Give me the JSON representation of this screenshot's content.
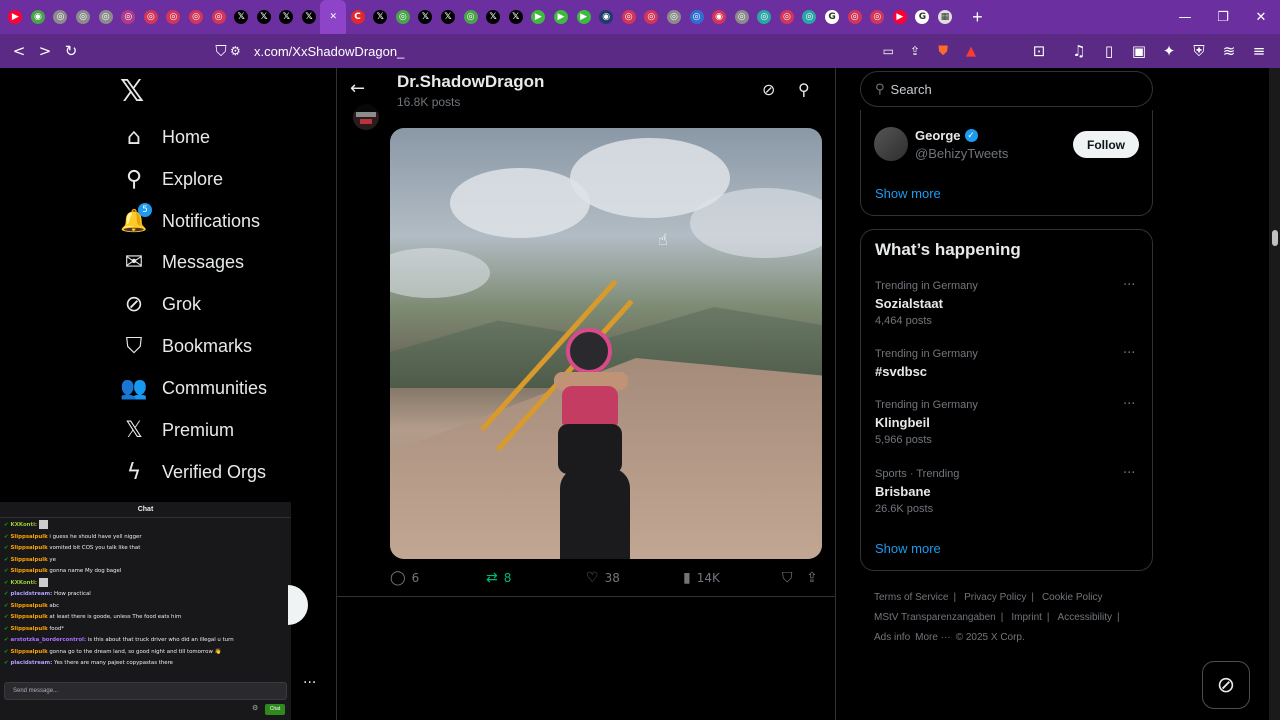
{
  "browser": {
    "tab_favicons": [
      {
        "icon": "youtube-icon",
        "color": "#ff0033",
        "glyph": "▶"
      },
      {
        "icon": "play-icon",
        "color": "#4aa34a",
        "glyph": "◉"
      },
      {
        "icon": "site-icon",
        "color": "#8b8b8b",
        "glyph": "◎"
      },
      {
        "icon": "site-icon",
        "color": "#8b8b8b",
        "glyph": "◎"
      },
      {
        "icon": "site-icon",
        "color": "#8b8b8b",
        "glyph": "◎"
      },
      {
        "icon": "site-icon",
        "color": "#b03a8a",
        "glyph": "◎"
      },
      {
        "icon": "site-icon",
        "color": "#d1365a",
        "glyph": "◎"
      },
      {
        "icon": "site-icon",
        "color": "#d1365a",
        "glyph": "◎"
      },
      {
        "icon": "site-icon",
        "color": "#d1365a",
        "glyph": "◎"
      },
      {
        "icon": "site-icon",
        "color": "#d1365a",
        "glyph": "◎"
      },
      {
        "icon": "x-icon",
        "color": "#000000",
        "glyph": "𝕏"
      },
      {
        "icon": "x-icon",
        "color": "#000000",
        "glyph": "𝕏"
      },
      {
        "icon": "x-icon",
        "color": "#000000",
        "glyph": "𝕏"
      },
      {
        "icon": "x-icon",
        "color": "#000000",
        "glyph": "𝕏"
      },
      {
        "icon": "close-tab-icon",
        "color": "#8e44c9",
        "glyph": "✕",
        "active": true
      },
      {
        "icon": "c-icon",
        "color": "#e0282e",
        "glyph": "C"
      },
      {
        "icon": "x-icon",
        "color": "#000000",
        "glyph": "𝕏"
      },
      {
        "icon": "site-icon",
        "color": "#4aa34a",
        "glyph": "◎"
      },
      {
        "icon": "x-icon",
        "color": "#000000",
        "glyph": "𝕏"
      },
      {
        "icon": "x-icon",
        "color": "#000000",
        "glyph": "𝕏"
      },
      {
        "icon": "site-icon",
        "color": "#4aa34a",
        "glyph": "◎"
      },
      {
        "icon": "x-icon",
        "color": "#000000",
        "glyph": "𝕏"
      },
      {
        "icon": "x-icon",
        "color": "#000000",
        "glyph": "𝕏"
      },
      {
        "icon": "play-icon",
        "color": "#3fb93f",
        "glyph": "▶"
      },
      {
        "icon": "play-icon",
        "color": "#3fb93f",
        "glyph": "▶"
      },
      {
        "icon": "play-icon",
        "color": "#3fb93f",
        "glyph": "▶"
      },
      {
        "icon": "site-icon",
        "color": "#1f3a6b",
        "glyph": "◉"
      },
      {
        "icon": "site-icon",
        "color": "#d1365a",
        "glyph": "◎"
      },
      {
        "icon": "site-icon",
        "color": "#d1365a",
        "glyph": "◎"
      },
      {
        "icon": "site-icon",
        "color": "#8b8b8b",
        "glyph": "◎"
      },
      {
        "icon": "site-icon",
        "color": "#2f6fd1",
        "glyph": "◎"
      },
      {
        "icon": "site-icon",
        "color": "#d1365a",
        "glyph": "◉"
      },
      {
        "icon": "site-icon",
        "color": "#8b8b8b",
        "glyph": "◎"
      },
      {
        "icon": "site-icon",
        "color": "#2aa6a6",
        "glyph": "◎"
      },
      {
        "icon": "site-icon",
        "color": "#d1365a",
        "glyph": "◎"
      },
      {
        "icon": "site-icon",
        "color": "#2aa6a6",
        "glyph": "◎"
      },
      {
        "icon": "google-icon",
        "color": "#ffffff",
        "glyph": "G"
      },
      {
        "icon": "site-icon",
        "color": "#d1365a",
        "glyph": "◎"
      },
      {
        "icon": "site-icon",
        "color": "#d1365a",
        "glyph": "◎"
      },
      {
        "icon": "youtube-icon",
        "color": "#ff0033",
        "glyph": "▶"
      },
      {
        "icon": "google-icon",
        "color": "#ffffff",
        "glyph": "G"
      },
      {
        "icon": "image-icon",
        "color": "#dddddd",
        "glyph": "▦"
      }
    ],
    "new_tab": "+",
    "url": "x.com/XxShadowDragon_",
    "accent": "#6b2fa0"
  },
  "nav": {
    "items": [
      {
        "label": "Home",
        "icon": "home-icon",
        "glyph": "⌂"
      },
      {
        "label": "Explore",
        "icon": "search-icon",
        "glyph": "⚲"
      },
      {
        "label": "Notifications",
        "icon": "bell-icon",
        "glyph": "🔔",
        "badge": "5"
      },
      {
        "label": "Messages",
        "icon": "envelope-icon",
        "glyph": "✉"
      },
      {
        "label": "Grok",
        "icon": "grok-icon",
        "glyph": "⊘"
      },
      {
        "label": "Bookmarks",
        "icon": "bookmark-icon",
        "glyph": "⛉"
      },
      {
        "label": "Communities",
        "icon": "communities-icon",
        "glyph": "👥"
      },
      {
        "label": "Premium",
        "icon": "x-premium-icon",
        "glyph": "𝕏"
      },
      {
        "label": "Verified Orgs",
        "icon": "lightning-icon",
        "glyph": "ϟ"
      }
    ]
  },
  "profile": {
    "title": "Dr.ShadowDragon",
    "post_count": "16.8K posts"
  },
  "post": {
    "replies": "6",
    "reposts": "8",
    "likes": "38",
    "views": "14K"
  },
  "right": {
    "search_placeholder": "Search",
    "who_to_follow": {
      "name": "George",
      "handle": "@BehizyTweets",
      "follow_label": "Follow",
      "show_more": "Show more"
    },
    "whats_happening": {
      "title": "What’s happening",
      "trends": [
        {
          "category": "Trending in Germany",
          "name": "Sozialstaat",
          "count": "4,464 posts"
        },
        {
          "category": "Trending in Germany",
          "name": "#svdbsc",
          "count": ""
        },
        {
          "category": "Trending in Germany",
          "name": "Klingbeil",
          "count": "5,966 posts"
        },
        {
          "category": "Sports · Trending",
          "name": "Brisbane",
          "count": "26.6K posts"
        }
      ],
      "show_more": "Show more"
    },
    "footer": {
      "links": [
        "Terms of Service",
        "Privacy Policy",
        "Cookie Policy",
        "MStV Transparenzangaben",
        "Imprint",
        "Accessibility",
        "Ads info",
        "More ···"
      ],
      "copyright": "© 2025 X Corp."
    }
  },
  "chat": {
    "title": "Chat",
    "messages": [
      {
        "user": "KXKonti:",
        "color": "#9acd32",
        "text": "",
        "emote": true
      },
      {
        "user": "Slippsalpulk",
        "color": "#ffa500",
        "text": "i guess he should have yell nigger"
      },
      {
        "user": "Slippsalpulk",
        "color": "#ffa500",
        "text": "vomited bit COS you talk like that"
      },
      {
        "user": "Slippsalpulk",
        "color": "#ffa500",
        "text": "ye"
      },
      {
        "user": "Slippsalpulk",
        "color": "#ffa500",
        "text": "gonna name My dog bagel"
      },
      {
        "user": "KXKonti:",
        "color": "#9acd32",
        "text": "",
        "emote": true
      },
      {
        "user": "placidstream:",
        "color": "#b3a1ff",
        "text": "How practical"
      },
      {
        "user": "Slippsalpulk",
        "color": "#ffa500",
        "text": "abc"
      },
      {
        "user": "Slippsalpulk",
        "color": "#ffa500",
        "text": "at least there is goode, unless The food eats him"
      },
      {
        "user": "Slippsalpulk",
        "color": "#ffa500",
        "text": "food*"
      },
      {
        "user": "arstotzka_bordercontrol:",
        "color": "#a970ff",
        "text": "is this about that truck driver who did an illegal u turn"
      },
      {
        "user": "Slippsalpulk",
        "color": "#ffa500",
        "text": "gonna go to the dream land, so good night and till tomorrow 👋"
      },
      {
        "user": "placidstream:",
        "color": "#b3a1ff",
        "text": "Yes there are many pajeet copypastas there"
      }
    ],
    "input_placeholder": "Send message...",
    "send_label": "Chat"
  }
}
